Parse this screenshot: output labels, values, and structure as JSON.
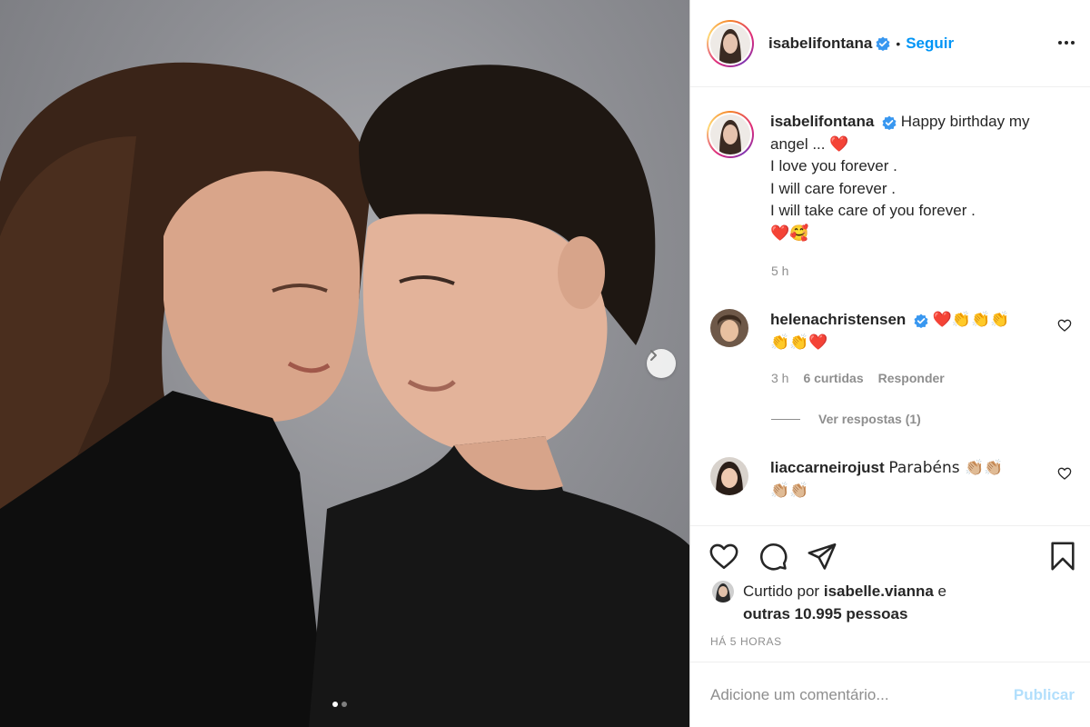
{
  "post": {
    "author": "isabelifontana",
    "follow_label": "Seguir",
    "separator": "•",
    "caption_lines": [
      "Happy birthday my",
      "angel ...",
      "I love you forever .",
      "I will care forever .",
      "I will take care of you forever ."
    ],
    "caption_emoji_1": "❤️",
    "caption_emoji_2": "❤️🥰",
    "time": "5 h",
    "carousel": {
      "current": 1,
      "total": 2
    }
  },
  "comments": [
    {
      "user": "helenachristensen",
      "text_line1": "❤️👏👏👏",
      "text_line2": "👏👏❤️",
      "time": "3 h",
      "likes": "6 curtidas",
      "reply_label": "Responder",
      "view_replies": "Ver respostas (1)"
    },
    {
      "user": "liaccarneirojust",
      "text_line1": "Parabéns 👏🏼👏🏼",
      "text_line2": "👏🏼👏🏼"
    }
  ],
  "likes": {
    "prefix": "Curtido por",
    "user": "isabelle.vianna",
    "conj": "e",
    "others": "outras 10.995 pessoas"
  },
  "posted_ago": "HÁ 5 HORAS",
  "add_comment": {
    "placeholder": "Adicione um comentário...",
    "publish_label": "Publicar"
  },
  "colors": {
    "accent": "#0095f6",
    "publish_disabled": "#b2dffc",
    "heart": "#e0141e",
    "muted": "#8e8e8e"
  },
  "icons": [
    "next-arrow-icon",
    "verified-icon",
    "more-options-icon",
    "like-icon",
    "comment-icon",
    "share-icon",
    "bookmark-icon"
  ]
}
